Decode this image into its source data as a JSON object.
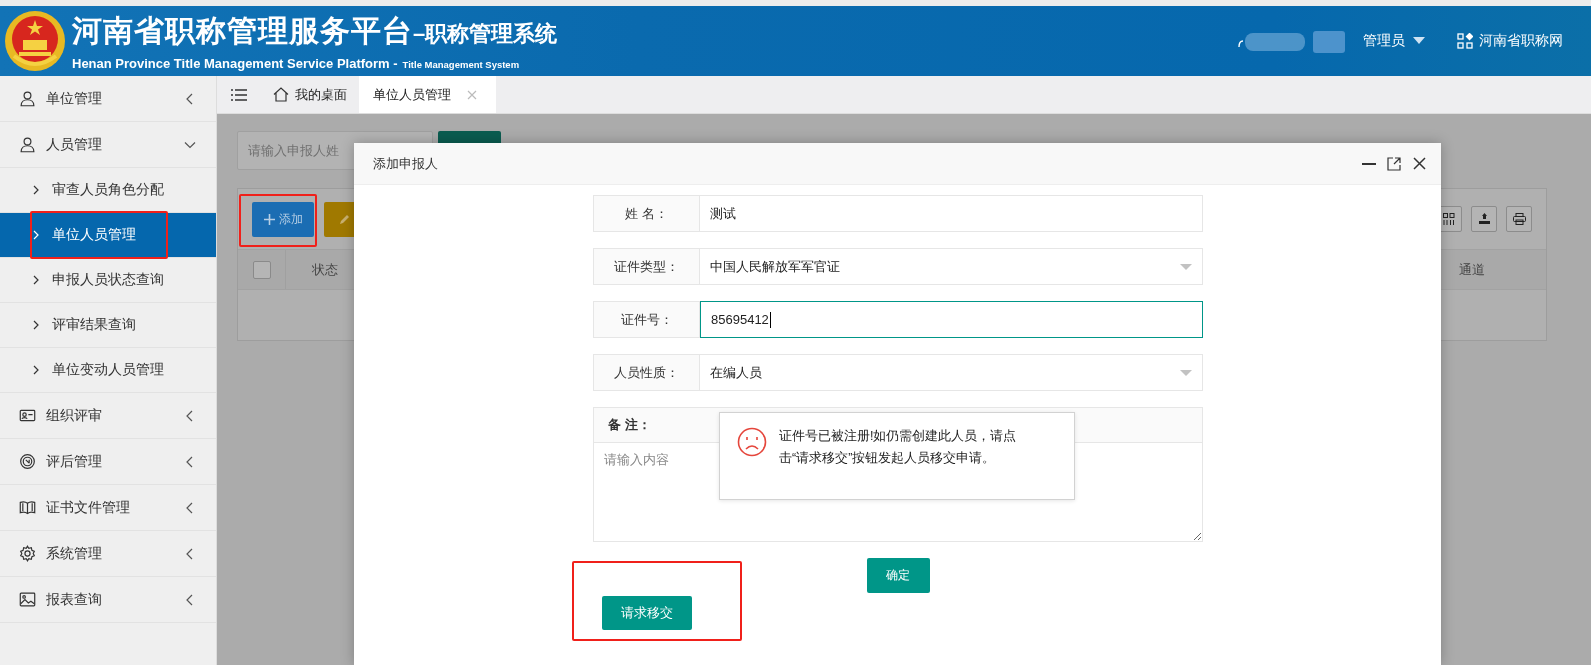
{
  "header": {
    "title": "河南省职称管理服务平台",
    "title_suffix": "–职称管理系统",
    "subtitle": "Henan Province Title Management Service Platform -",
    "subtitle_suffix": "Title Management System",
    "user": "管理员",
    "site_link": "河南省职称网"
  },
  "sidebar": [
    {
      "label": "单位管理",
      "kind": "user",
      "expanded": false
    },
    {
      "label": "人员管理",
      "kind": "user",
      "expanded": true,
      "children": [
        {
          "label": "审查人员角色分配",
          "selected": false,
          "highlighted": false
        },
        {
          "label": "单位人员管理",
          "selected": true,
          "highlighted": true
        },
        {
          "label": "申报人员状态查询",
          "selected": false,
          "highlighted": false
        },
        {
          "label": "评审结果查询",
          "selected": false,
          "highlighted": false
        },
        {
          "label": "单位变动人员管理",
          "selected": false,
          "highlighted": false
        }
      ]
    },
    {
      "label": "组织评审",
      "kind": "idcard",
      "expanded": false
    },
    {
      "label": "评后管理",
      "kind": "badge",
      "expanded": false
    },
    {
      "label": "证书文件管理",
      "kind": "book",
      "expanded": false
    },
    {
      "label": "系统管理",
      "kind": "gear",
      "expanded": false
    },
    {
      "label": "报表查询",
      "kind": "image",
      "expanded": false
    }
  ],
  "tabs": [
    {
      "label": "我的桌面",
      "kind": "home",
      "selected": false,
      "closable": false
    },
    {
      "label": "单位人员管理",
      "kind": "plain",
      "selected": true,
      "closable": true
    }
  ],
  "page": {
    "search_placeholder": "请输入申报人姓",
    "add_button": {
      "label": "添加",
      "highlighted": true
    },
    "select_all_checked": false,
    "columns": [
      "状态",
      "通道"
    ]
  },
  "dialog": {
    "title": "添加申报人",
    "fields": [
      {
        "kind": "text",
        "label": "姓 名：",
        "value": "测试",
        "focused": false
      },
      {
        "kind": "select",
        "label": "证件类型：",
        "value": "中国人民解放军军官证"
      },
      {
        "kind": "text",
        "label": "证件号：",
        "value": "85695412",
        "focused": true
      },
      {
        "kind": "select",
        "label": "人员性质：",
        "value": "在编人员"
      },
      {
        "kind": "textarea",
        "label": "备 注：",
        "placeholder": "请输入内容"
      }
    ],
    "confirm_button": "确定",
    "transfer_button": {
      "label": "请求移交",
      "highlighted": true
    }
  },
  "alert": {
    "message": "证件号已被注册!如仍需创建此人员，请点击“请求移交”按钮发起人员移交申请。"
  }
}
